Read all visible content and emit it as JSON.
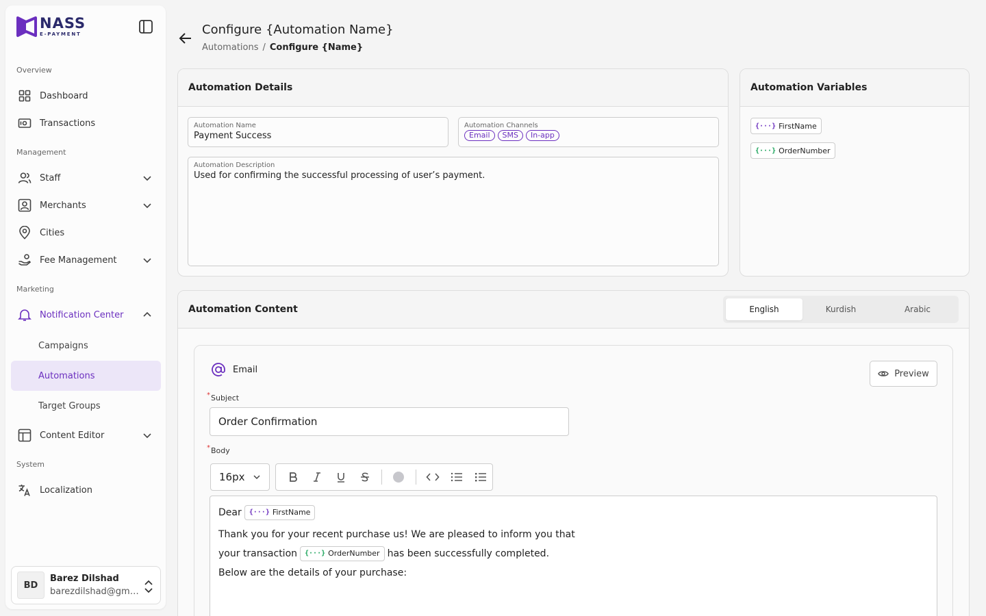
{
  "brand": {
    "name": "NASS",
    "tagline": "E-PAYMENT",
    "color": "#6b2fbf"
  },
  "sidebar": {
    "sections": {
      "overview": "Overview",
      "management": "Management",
      "marketing": "Marketing",
      "system": "System"
    },
    "items": {
      "dashboard": "Dashboard",
      "transactions": "Transactions",
      "staff": "Staff",
      "merchants": "Merchants",
      "cities": "Cities",
      "fee_management": "Fee Management",
      "notification_center": "Notification Center",
      "campaigns": "Campaigns",
      "automations": "Automations",
      "target_groups": "Target Groups",
      "content_editor": "Content Editor",
      "localization": "Localization"
    },
    "user": {
      "initials": "BD",
      "name": "Barez Dilshad",
      "email": "barezdilshad@gmail.com"
    }
  },
  "header": {
    "title": "Configure {Automation Name}",
    "breadcrumb": {
      "parent": "Automations",
      "separator": "/",
      "current": "Configure {Name}"
    }
  },
  "details": {
    "title": "Automation Details",
    "name_label": "Automation Name",
    "name_value": "Payment Success",
    "channels_label": "Automation Channels",
    "channels": [
      "Email",
      "SMS",
      "In-app"
    ],
    "description_label": "Automation Description",
    "description_value": "Used for confirming the successful processing of user’s payment."
  },
  "variables": {
    "title": "Automation Variables",
    "items": [
      "FirstName",
      "OrderNumber"
    ]
  },
  "content": {
    "title": "Automation Content",
    "tabs": [
      "English",
      "Kurdish",
      "Arabic"
    ],
    "active_tab": "English",
    "channel": "Email",
    "preview_label": "Preview",
    "subject_label": "Subject",
    "subject_value": "Order Confirmation",
    "body_label": "Body",
    "font_size": "16px",
    "body": {
      "greeting": "Dear",
      "greeting_var": "FirstName",
      "line2": "Thank you for your recent purchase us! We are pleased to inform you that",
      "line3_pre": "your transaction",
      "line3_var": "OrderNumber",
      "line3_post": "has been successfully completed.",
      "line4": "Below are the details of your purchase:"
    }
  }
}
